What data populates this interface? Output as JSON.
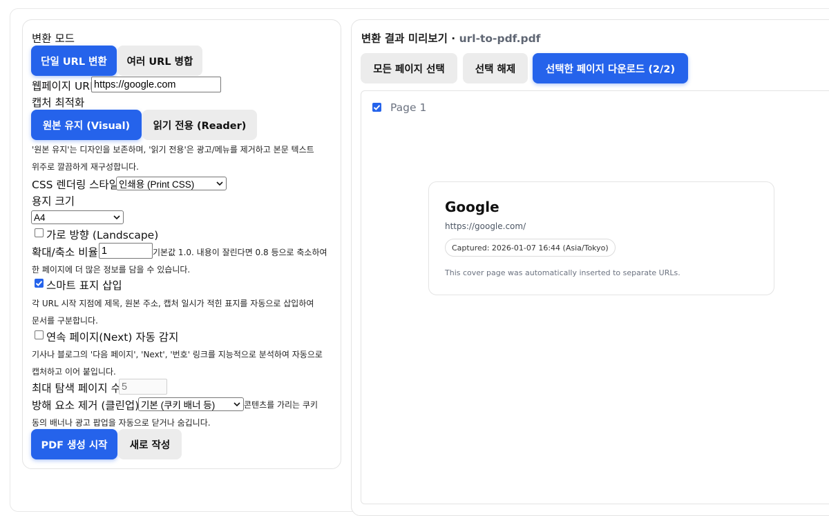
{
  "form": {
    "mode_label": "변환 모드",
    "mode_single": "단일 URL 변환",
    "mode_merge": "여러 URL 병합",
    "url_label": "웹페이지 URL",
    "url_value": "https://google.com",
    "capture_label": "캡처 최적화",
    "capture_visual": "원본 유지 (Visual)",
    "capture_reader": "읽기 전용 (Reader)",
    "capture_help_1": "'원본 유지'는 디자인을 보존하며, '읽기 전용'은 광고/메뉴를 제거하고 본문 텍스트",
    "capture_help_2": "위주로 깔끔하게 재구성합니다.",
    "css_label": "CSS 렌더링 스타일",
    "css_value": "인쇄용 (Print CSS)",
    "paper_label": "용지 크기",
    "paper_value": "A4",
    "landscape_label": "가로 방향 (Landscape)",
    "landscape_checked": false,
    "scale_label": "확대/축소 비율",
    "scale_value": "1",
    "scale_help_1": "기본값 1.0. 내용이 잘린다면 0.8 등으로 축소하여",
    "scale_help_2": "한 페이지에 더 많은 정보를 담을 수 있습니다.",
    "smart_label": "스마트 표지 삽입",
    "smart_checked": true,
    "smart_help_1": "각 URL 시작 지점에 제목, 원본 주소, 캡처 일시가 적힌 표지를 자동으로 삽입하여",
    "smart_help_2": "문서를 구분합니다.",
    "next_label": "연속 페이지(Next) 자동 감지",
    "next_checked": false,
    "next_help_1": "기사나 블로그의 '다음 페이지', 'Next', '번호' 링크를 지능적으로 분석하여 자동으로",
    "next_help_2": "캡처하고 이어 붙입니다.",
    "max_pages_label": "최대 탐색 페이지 수",
    "max_pages_value": "5",
    "cleanup_label": "방해 요소 제거 (클린업)",
    "cleanup_value": "기본 (쿠키 배너 등)",
    "cleanup_help_1": "콘텐츠를 가리는 쿠키",
    "cleanup_help_2": "동의 배너나 광고 팝업을 자동으로 닫거나 숨깁니다.",
    "start_button": "PDF 생성 시작",
    "reset_button": "새로 작성"
  },
  "preview": {
    "title": "변환 결과 미리보기 ·",
    "filename": "url-to-pdf.pdf",
    "select_all": "모든 페이지 선택",
    "deselect": "선택 해제",
    "download": "선택한 페이지 다운로드 (2/2)",
    "page_label": "Page 1",
    "page_checked": true
  },
  "cover": {
    "title": "Google",
    "url": "https://google.com/",
    "captured": "Captured: 2026-01-07 16:44 (Asia/Tokyo)",
    "note": "This cover page was automatically inserted to separate URLs."
  },
  "colors": {
    "primary": "#2563eb",
    "secondary": "#ececec"
  },
  "icons": {
    "select_chevron": "chevron-down-icon",
    "checkbox_check": "check-icon"
  }
}
